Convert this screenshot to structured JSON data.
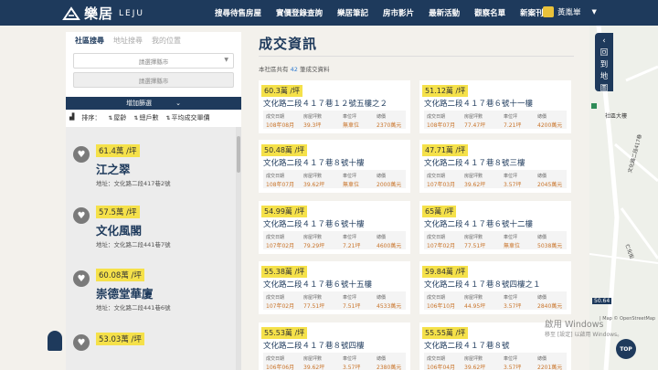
{
  "nav": {
    "logo_text": "樂居",
    "logo_sub": "LEJU",
    "links": [
      "搜尋待售房屋",
      "實價登錄查詢",
      "樂居筆記",
      "房市影片",
      "最新活動",
      "觀察名單",
      "新案刊登"
    ],
    "user_name": "黃胤崋",
    "colors": {
      "navy": "#1e3a5c",
      "highlight": "#f5e14a",
      "accent_value": "#c9742a"
    }
  },
  "sidebar": {
    "tabs": [
      "社區搜尋",
      "地址搜尋",
      "我的位置"
    ],
    "city_placeholder": "請選擇縣市",
    "district_placeholder": "請選擇縣市",
    "filter_label": "增加篩選",
    "sort_label": "排序：",
    "sort_options": [
      "屋齡",
      "總戶數",
      "平均成交單價"
    ],
    "communities": [
      {
        "price": "61.4萬 /坪",
        "name": "江之翠",
        "address": "地址：文化路二段417巷2號"
      },
      {
        "price": "57.5萬 /坪",
        "name": "文化風閣",
        "address": "地址：文化路二段441巷7號"
      },
      {
        "price": "60.08萬 /坪",
        "name": "崇德堂華廈",
        "address": "地址：文化路二段441巷6號"
      },
      {
        "price": "53.03萬 /坪",
        "name": "",
        "address": ""
      }
    ]
  },
  "main": {
    "title": "成交資訊",
    "count_prefix": "本社區共有",
    "count": "42",
    "count_suffix": "筆成交資料",
    "field_labels": [
      "成交日期",
      "房屋坪數",
      "車位坪",
      "總價"
    ],
    "deals": [
      {
        "price": "60.3萬 /坪",
        "address": "文化路二段４１７巷１２號五樓之２",
        "date": "108年08月",
        "area": "39.3坪",
        "parking": "無車位",
        "total": "2370萬元"
      },
      {
        "price": "51.12萬 /坪",
        "address": "文化路二段４１７巷６號十一樓",
        "date": "108年07月",
        "area": "77.47坪",
        "parking": "7.21坪",
        "total": "4200萬元"
      },
      {
        "price": "50.48萬 /坪",
        "address": "文化路二段４１７巷８號十樓",
        "date": "108年07月",
        "area": "39.62坪",
        "parking": "無車位",
        "total": "2000萬元"
      },
      {
        "price": "47.71萬 /坪",
        "address": "文化路二段４１７巷８號三樓",
        "date": "107年03月",
        "area": "39.62坪",
        "parking": "3.57坪",
        "total": "2045萬元"
      },
      {
        "price": "54.99萬 /坪",
        "address": "文化路二段４１７巷６號十樓",
        "date": "107年02月",
        "area": "79.29坪",
        "parking": "7.21坪",
        "total": "4600萬元"
      },
      {
        "price": "65萬 /坪",
        "address": "文化路二段４１７巷６號十二樓",
        "date": "107年02月",
        "area": "77.51坪",
        "parking": "無車位",
        "total": "5038萬元"
      },
      {
        "price": "55.38萬 /坪",
        "address": "文化路二段４１７巷６號十五樓",
        "date": "107年02月",
        "area": "77.51坪",
        "parking": "7.51坪",
        "total": "4533萬元"
      },
      {
        "price": "59.84萬 /坪",
        "address": "文化路二段４１７巷８號四樓之１",
        "date": "106年10月",
        "area": "44.95坪",
        "parking": "3.57坪",
        "total": "2840萬元"
      },
      {
        "price": "55.53萬 /坪",
        "address": "文化路二段４１７巷８號四樓",
        "date": "106年06月",
        "area": "39.62坪",
        "parking": "3.57坪",
        "total": "2380萬元"
      },
      {
        "price": "55.55萬 /坪",
        "address": "文化路二段４１７巷８號",
        "date": "106年04月",
        "area": "39.62坪",
        "parking": "3.57坪",
        "total": "2201萬元"
      }
    ]
  },
  "map": {
    "collapse_tab": [
      "回",
      "到",
      "地",
      "圖"
    ],
    "top_button": "TOP",
    "labels": [
      "社區大樓",
      "文化路二段417巷",
      "仁化街"
    ],
    "credit": "| Map © OpenStreetMap",
    "marker_label": "50.64"
  },
  "watermark": {
    "line1": "啟用 Windows",
    "line2": "移至 [設定] 以啟用 Windows。"
  }
}
